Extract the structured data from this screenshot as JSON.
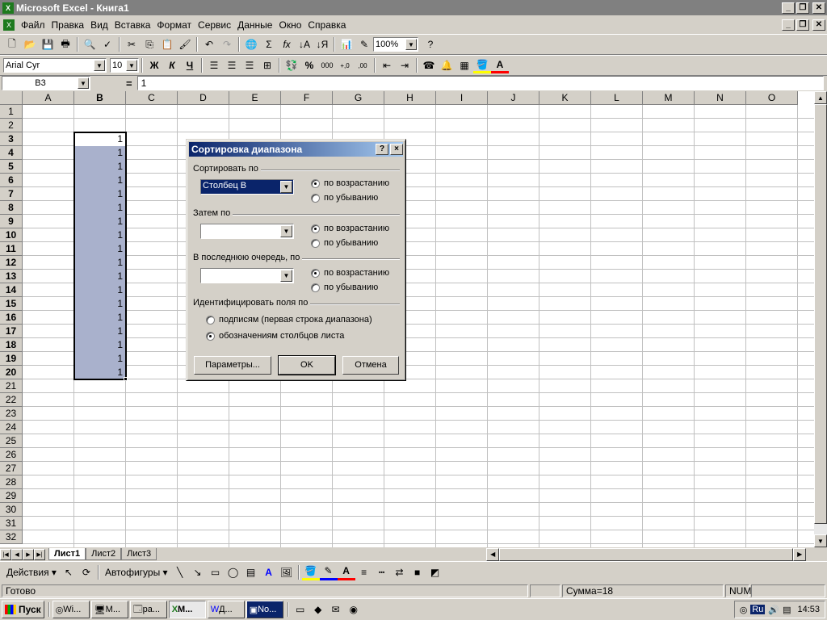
{
  "window": {
    "title": "Microsoft Excel - Книга1"
  },
  "menu": [
    "Файл",
    "Правка",
    "Вид",
    "Вставка",
    "Формат",
    "Сервис",
    "Данные",
    "Окно",
    "Справка"
  ],
  "toolbar": {
    "zoom": "100%"
  },
  "format_toolbar": {
    "font": "Arial Cyr",
    "size": "10",
    "bold": "Ж",
    "italic": "К",
    "underline": "Ч",
    "percent": "%",
    "thousands": "000"
  },
  "formula_bar": {
    "cell_ref": "B3",
    "equals": "=",
    "value": "1"
  },
  "grid": {
    "columns": [
      "A",
      "B",
      "C",
      "D",
      "E",
      "F",
      "G",
      "H",
      "I",
      "J",
      "K",
      "L",
      "M",
      "N",
      "O"
    ],
    "rows": [
      "1",
      "2",
      "3",
      "4",
      "5",
      "6",
      "7",
      "8",
      "9",
      "10",
      "11",
      "12",
      "13",
      "14",
      "15",
      "16",
      "17",
      "18",
      "19",
      "20",
      "21",
      "22",
      "23",
      "24",
      "25",
      "26",
      "27",
      "28",
      "29",
      "30",
      "31",
      "32"
    ],
    "column_b_values": [
      "1",
      "1",
      "1",
      "1",
      "1",
      "1",
      "1",
      "1",
      "1",
      "1",
      "1",
      "1",
      "1",
      "1",
      "1",
      "1",
      "1",
      "1"
    ],
    "selection_color": "#a9b1cc"
  },
  "sheets": [
    "Лист1",
    "Лист2",
    "Лист3"
  ],
  "drawing_toolbar": {
    "actions": "Действия",
    "autoshapes": "Автофигуры"
  },
  "status": {
    "ready": "Готово",
    "sum": "Сумма=18",
    "num": "NUM"
  },
  "taskbar": {
    "start": "Пуск",
    "tasks": [
      "Wi...",
      "M...",
      "ра...",
      "M...",
      "Д...",
      "No..."
    ],
    "clock": "14:53",
    "lang": "Ru"
  },
  "dialog": {
    "title": "Сортировка диапазона",
    "sort_by_label": "Сортировать по",
    "sort_by_value": "Столбец B",
    "then_by_label": "Затем по",
    "last_by_label": "В последнюю очередь, по",
    "ascending": "по возрастанию",
    "descending": "по убыванию",
    "identify_label": "Идентифицировать поля по",
    "opt_headers": "подписям (первая строка диапазона)",
    "opt_columns": "обозначениям столбцов листа",
    "params_btn": "Параметры...",
    "ok_btn": "OK",
    "cancel_btn": "Отмена",
    "help_btn": "?",
    "close_btn": "×"
  }
}
